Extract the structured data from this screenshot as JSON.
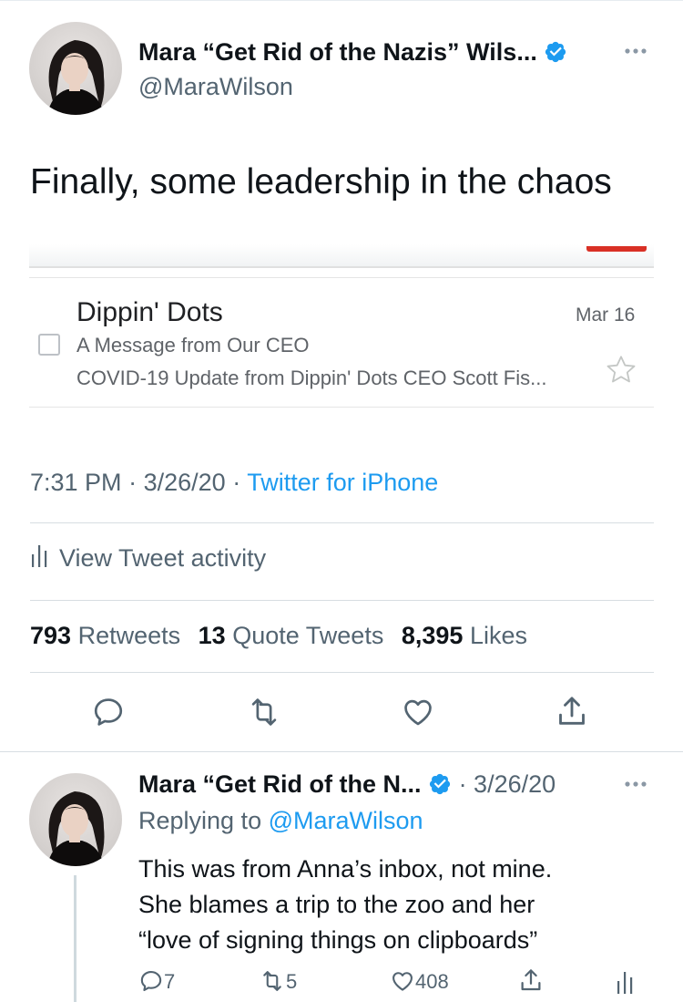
{
  "tweet": {
    "author_name": "Mara “Get Rid of the Nazis” Wils...",
    "handle": "@MaraWilson",
    "text": "Finally, some leadership in the chaos",
    "time": "7:31 PM",
    "date": "3/26/20",
    "source": "Twitter for iPhone",
    "sep": "·",
    "activity_label": "View Tweet activity",
    "stats": {
      "retweets_count": "793",
      "retweets_label": "Retweets",
      "quotes_count": "13",
      "quotes_label": "Quote Tweets",
      "likes_count": "8,395",
      "likes_label": "Likes"
    }
  },
  "email": {
    "sender": "Dippin' Dots",
    "date": "Mar 16",
    "subject": "A Message from Our CEO",
    "preview": "COVID-19 Update from Dippin' Dots CEO Scott Fis..."
  },
  "reply": {
    "author_name": "Mara “Get Rid of the N...",
    "date": "· 3/26/20",
    "replying_prefix": "Replying to",
    "replying_handle": "@MaraWilson",
    "line1": "This was from Anna’s inbox, not mine.",
    "line2": "She blames a trip to the zoo and her",
    "line3": "“love of signing things on clipboards”",
    "reply_count": "7",
    "retweet_count": "5",
    "like_count": "408"
  },
  "colors": {
    "accent": "#1d9bf0",
    "secondary_text": "#536471",
    "divider": "#d7dde2",
    "email_accent": "#d93025"
  },
  "icons": [
    "verified-icon",
    "more-icon",
    "reply-icon",
    "retweet-icon",
    "like-icon",
    "share-icon",
    "analytics-icon",
    "checkbox-icon",
    "star-icon"
  ]
}
